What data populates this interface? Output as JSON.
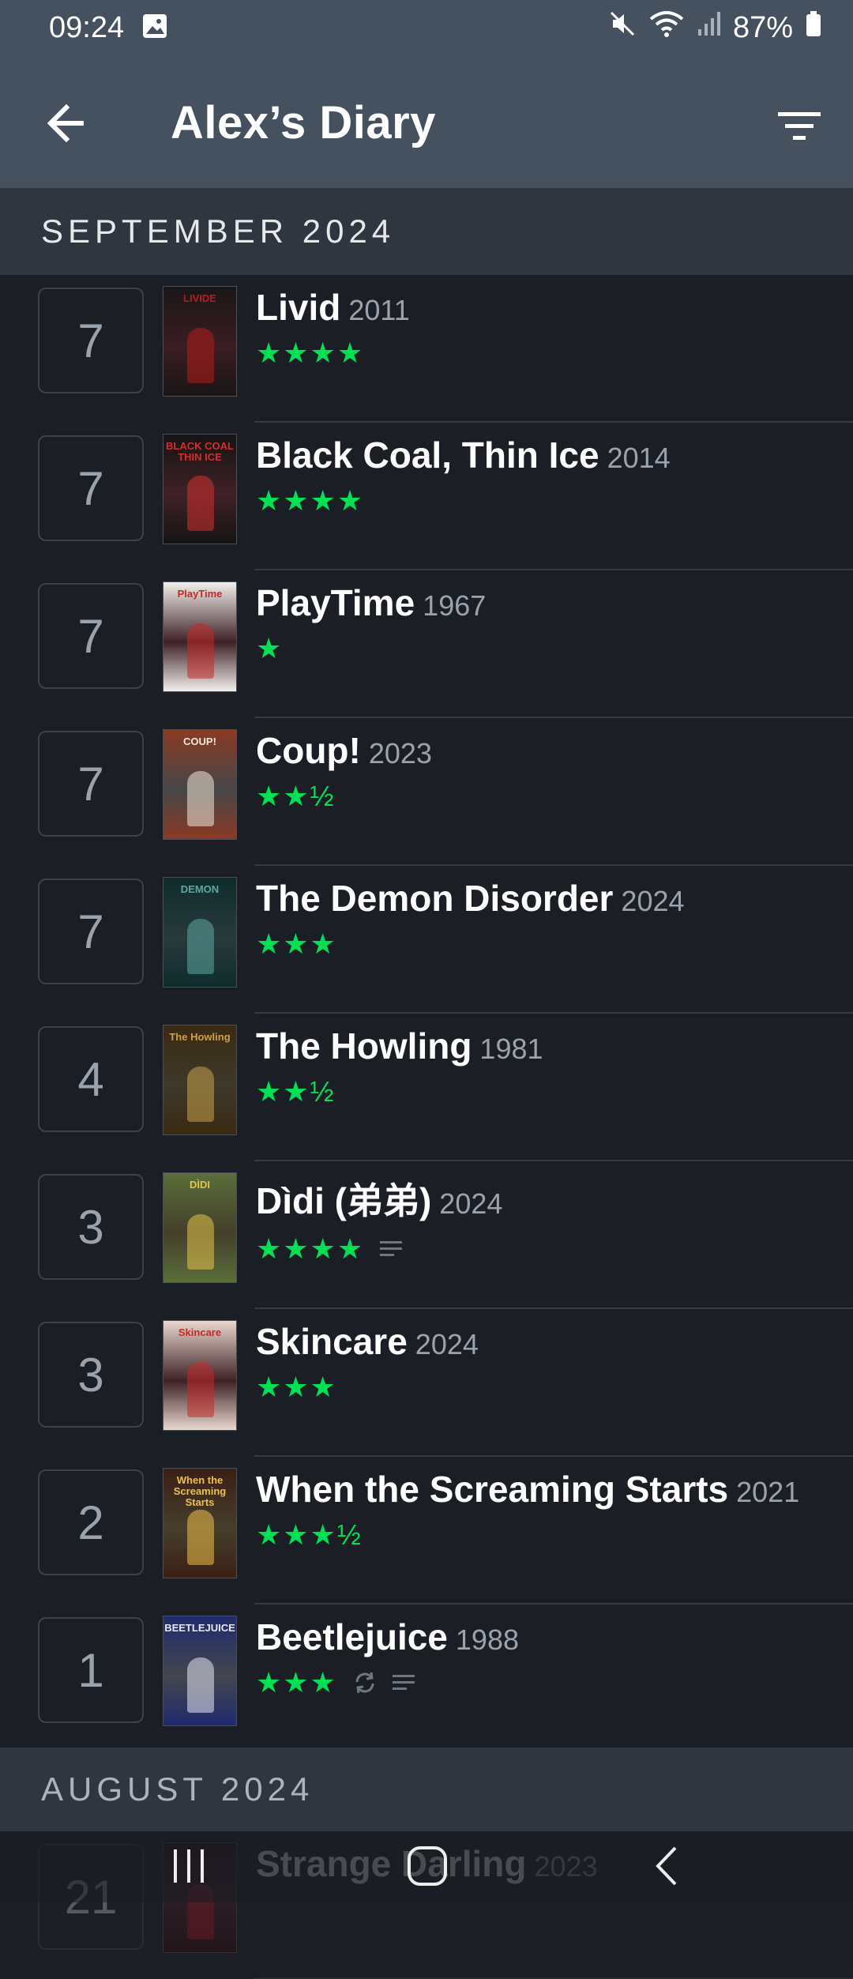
{
  "status_bar": {
    "time": "09:24",
    "battery": "87%",
    "icons": [
      "gallery-icon",
      "mute-icon",
      "wifi-icon",
      "signal-icon",
      "battery-icon"
    ]
  },
  "app_bar": {
    "title": "Alex’s Diary",
    "back_icon": "arrow-left-icon",
    "filter_icon": "filter-icon"
  },
  "sections": [
    {
      "month": "SEPTEMBER 2024",
      "entries": [
        {
          "day": "7",
          "title": "Livid",
          "year": "2011",
          "stars": "★★★★",
          "rating": 4,
          "extras": [],
          "poster": {
            "bg": "#1a1516",
            "accent": "#b71c1c",
            "text": "LIVIDE"
          }
        },
        {
          "day": "7",
          "title": "Black Coal, Thin Ice",
          "year": "2014",
          "stars": "★★★★",
          "rating": 4,
          "extras": [],
          "poster": {
            "bg": "#141414",
            "accent": "#d32f2f",
            "text": "BLACK COAL THIN ICE"
          }
        },
        {
          "day": "7",
          "title": "PlayTime",
          "year": "1967",
          "stars": "★",
          "rating": 1,
          "extras": [],
          "poster": {
            "bg": "#f2f0ec",
            "accent": "#c62828",
            "text": "PlayTime"
          }
        },
        {
          "day": "7",
          "title": "Coup!",
          "year": "2023",
          "stars": "★★½",
          "rating": 2.5,
          "extras": [],
          "poster": {
            "bg": "#8a3a24",
            "accent": "#f3e8d8",
            "text": "COUP!"
          }
        },
        {
          "day": "7",
          "title": "The Demon Disorder",
          "year": "2024",
          "stars": "★★★",
          "rating": 3,
          "extras": [],
          "poster": {
            "bg": "#0f2c2c",
            "accent": "#5fa8a0",
            "text": "DEMON"
          }
        },
        {
          "day": "4",
          "title": "The Howling",
          "year": "1981",
          "stars": "★★½",
          "rating": 2.5,
          "extras": [],
          "poster": {
            "bg": "#3a2a12",
            "accent": "#c9a34a",
            "text": "The Howling"
          }
        },
        {
          "day": "3",
          "title": "Dìdi (弟弟)",
          "year": "2024",
          "stars": "★★★★",
          "rating": 4,
          "extras": [
            "review-icon"
          ],
          "poster": {
            "bg": "#5b6e3a",
            "accent": "#e6c34a",
            "text": "DÌDI"
          }
        },
        {
          "day": "3",
          "title": "Skincare",
          "year": "2024",
          "stars": "★★★",
          "rating": 3,
          "extras": [],
          "poster": {
            "bg": "#e9d8cf",
            "accent": "#c62828",
            "text": "Skincare"
          }
        },
        {
          "day": "2",
          "title": "When the Screaming Starts",
          "year": "2021",
          "stars": "★★★½",
          "rating": 3.5,
          "extras": [],
          "poster": {
            "bg": "#3b1f14",
            "accent": "#f0c04a",
            "text": "When the Screaming Starts"
          }
        },
        {
          "day": "1",
          "title": "Beetlejuice",
          "year": "1988",
          "stars": "★★★",
          "rating": 3,
          "extras": [
            "rewatch-icon",
            "review-icon"
          ],
          "poster": {
            "bg": "#1f2a6e",
            "accent": "#e8e8f4",
            "text": "BEETLEJUICE"
          }
        }
      ]
    },
    {
      "month": "AUGUST 2024",
      "entries": [
        {
          "day": "21",
          "title": "Strange Darling",
          "year": "2023",
          "stars": "",
          "rating": null,
          "extras": [],
          "poster": {
            "bg": "#2a0b10",
            "accent": "#c2182b",
            "text": ""
          }
        }
      ]
    }
  ],
  "nav_bar": {
    "icons": [
      "recents-icon",
      "home-icon",
      "back-icon"
    ]
  },
  "colors": {
    "app_bar": "#45515f",
    "background": "#1b1e24",
    "section_header": "#2f3640",
    "star_green": "#00e054",
    "muted_text": "#9aa3ad"
  }
}
